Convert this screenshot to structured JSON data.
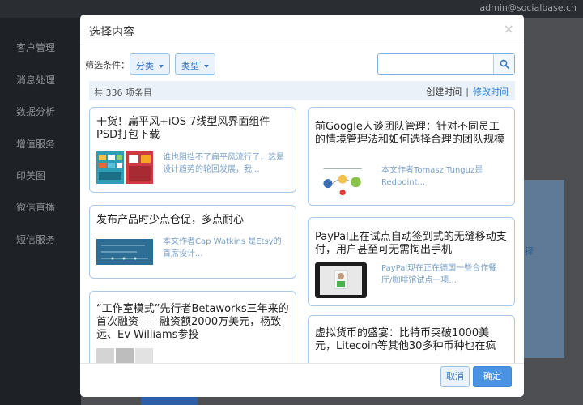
{
  "app": {
    "user": "admin@socialbase.cn",
    "sidebar_items": [
      "客户管理",
      "消息处理",
      "数据分析",
      "增值服务",
      "印美图",
      "微信直播",
      "短信服务"
    ],
    "bg_link_text": "择"
  },
  "modal": {
    "title": "选择内容",
    "close_glyph": "×",
    "filter_label": "筛选条件：",
    "dropdowns": [
      {
        "label": "分类"
      },
      {
        "label": "类型"
      }
    ],
    "search": {
      "value": "",
      "placeholder": ""
    },
    "count_text": "共 336 项条目",
    "sort": {
      "by_created": "创建时间",
      "separator": "|",
      "by_modified": "修改时间"
    },
    "cards": [
      {
        "title": "干货！扁平风+iOS 7线型风界面组件PSD打包下载",
        "excerpt": "谁也阻挡不了扁平风流行了，这是设计趋势的轮回发展，我..."
      },
      {
        "title": "发布产品时少点仓促，多点耐心",
        "excerpt": "本文作者Cap Watkins 是Etsy的首席设计..."
      },
      {
        "title": "“工作室模式”先行者Betaworks三年来的首次融资——融资额2000万美元，杨致远、Ev Williams参投",
        "excerpt": ""
      },
      {
        "title": "前Google人谈团队管理：针对不同员工的情境管理法和如何选择合理的团队规模",
        "excerpt": "本文作者Tomasz Tunguz是Redpoint..."
      },
      {
        "title": "PayPal正在试点自动签到式的无缝移动支付，用户甚至可无需掏出手机",
        "excerpt": "PayPal现在正在德国一些合作餐厅/咖啡馆试点一项..."
      },
      {
        "title": "虚拟货币的盛宴：比特币突破1000美元，Litecoin等其他30多种币种也在疯",
        "excerpt": ""
      }
    ],
    "cancel_label": "取消",
    "ok_label": "确定"
  },
  "colors": {
    "accent": "#4a93e3",
    "card_border": "#a9c9ea",
    "link": "#2f7fd0"
  }
}
